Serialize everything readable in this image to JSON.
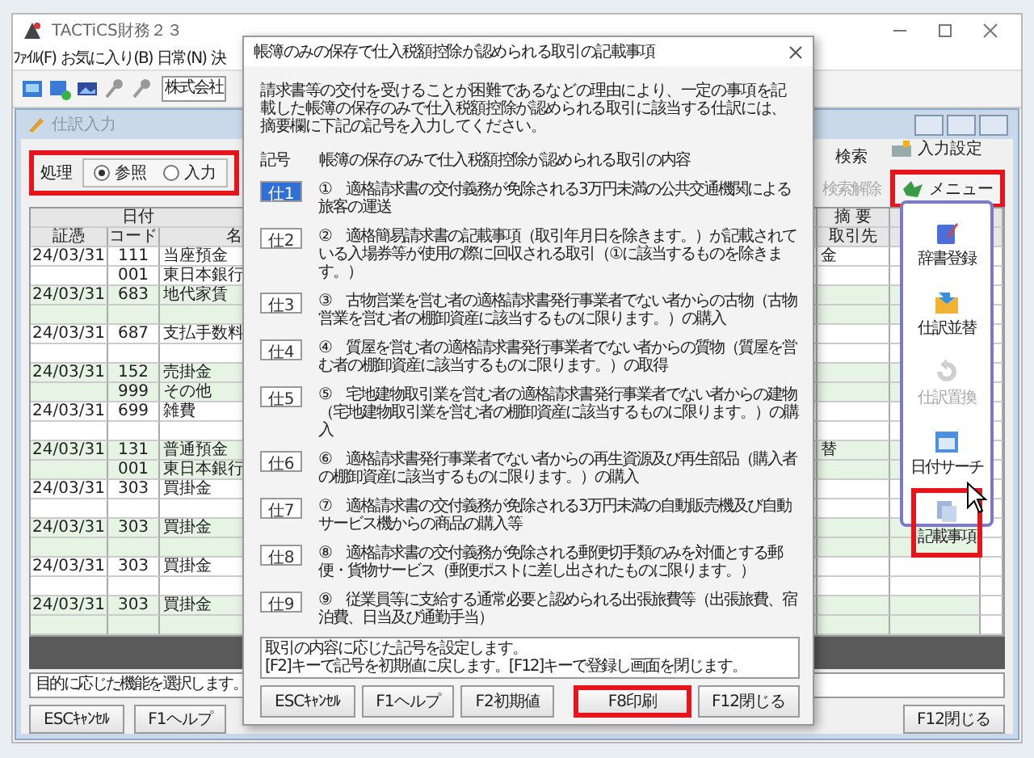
{
  "window": {
    "title": "TACTiCS財務２３"
  },
  "menu_bar": [
    "ﾌｧｲﾙ(F)",
    "お気に入り(B)",
    "日常(N)",
    "決"
  ],
  "toolbar": {
    "company_field": "株式会社"
  },
  "journal_window": {
    "title": "仕訳入力",
    "mode": {
      "label": "処理",
      "highlighted": true,
      "options": [
        {
          "label": "参照",
          "selected": true
        },
        {
          "label": "入力",
          "selected": false
        }
      ]
    },
    "search": "検索",
    "search_clear": {
      "label": "検索解除",
      "disabled": true
    },
    "input_settings": "入力設定",
    "menu_button": {
      "label": "メニュー",
      "highlighted": true
    },
    "table": {
      "date_header": "日付",
      "summary_header": "摘 要",
      "columns": [
        "証憑",
        "コード",
        "名"
      ],
      "partner_header": "取引先",
      "rows": [
        {
          "date": "24/03/31",
          "code": "111",
          "name": "当座預金",
          "summary": "金",
          "shaded": false
        },
        {
          "code": "001",
          "name": "東日本銀行",
          "shaded": false
        },
        {
          "date": "24/03/31",
          "code": "683",
          "name": "地代家賃",
          "shaded": true
        },
        {
          "shaded": true
        },
        {
          "date": "24/03/31",
          "code": "687",
          "name": "支払手数料",
          "shaded": false
        },
        {
          "shaded": false
        },
        {
          "date": "24/03/31",
          "code": "152",
          "name": "売掛金",
          "shaded": true
        },
        {
          "code": "999",
          "name": "その他",
          "shaded": true
        },
        {
          "date": "24/03/31",
          "code": "699",
          "name": "雑費",
          "shaded": false
        },
        {
          "shaded": false
        },
        {
          "date": "24/03/31",
          "code": "131",
          "name": "普通預金",
          "summary": "替",
          "shaded": true
        },
        {
          "code": "001",
          "name": "東日本銀行",
          "shaded": true
        },
        {
          "date": "24/03/31",
          "code": "303",
          "name": "買掛金",
          "shaded": false
        },
        {
          "shaded": false
        },
        {
          "date": "24/03/31",
          "code": "303",
          "name": "買掛金",
          "shaded": true
        },
        {
          "shaded": true
        },
        {
          "date": "24/03/31",
          "code": "303",
          "name": "買掛金",
          "shaded": false
        },
        {
          "shaded": false
        },
        {
          "date": "24/03/31",
          "code": "303",
          "name": "買掛金",
          "shaded": true
        },
        {
          "shaded": true
        }
      ]
    },
    "status_text": "目的に応じた機能を選択します。",
    "footer_buttons_left": [
      "ESCｷｬﾝｾﾙ",
      "F1ヘルプ"
    ],
    "footer_buttons_right": [
      "F12閉じる"
    ],
    "menu_panel": [
      {
        "kind": "dictionary",
        "label": "辞書登録",
        "disabled": false,
        "highlighted": false
      },
      {
        "kind": "sort",
        "label": "仕訳並替",
        "disabled": false,
        "highlighted": false
      },
      {
        "kind": "replace",
        "label": "仕訳置換",
        "disabled": true,
        "highlighted": false
      },
      {
        "kind": "calendar",
        "label": "日付サーチ",
        "disabled": false,
        "highlighted": false
      },
      {
        "kind": "notes",
        "label": "記載事項",
        "disabled": false,
        "highlighted": true
      }
    ]
  },
  "dialog": {
    "title": "帳簿のみの保存で仕入税額控除が認められる取引の記載事項",
    "intro": "請求書等の交付を受けることが困難であるなどの理由により、一定の事項を記載した帳簿の保存のみで仕入税額控除が認められる取引に該当する仕訳には、摘要欄に下記の記号を入力してください。",
    "header": {
      "code": "記号",
      "content": "帳簿の保存のみで仕入税額控除が認められる取引の内容"
    },
    "items": [
      {
        "code": "仕1",
        "selected": true,
        "text": "①　適格請求書の交付義務が免除される3万円未満の公共交通機関による旅客の運送"
      },
      {
        "code": "仕2",
        "selected": false,
        "text": "②　適格簡易請求書の記載事項（取引年月日を除きます。）が記載されている入場券等が使用の際に回収される取引（①に該当するものを除きます。）"
      },
      {
        "code": "仕3",
        "selected": false,
        "text": "③　古物営業を営む者の適格請求書発行事業者でない者からの古物（古物営業を営む者の棚卸資産に該当するものに限ります。）の購入"
      },
      {
        "code": "仕4",
        "selected": false,
        "text": "④　質屋を営む者の適格請求書発行事業者でない者からの質物（質屋を営む者の棚卸資産に該当するものに限ります。）の取得"
      },
      {
        "code": "仕5",
        "selected": false,
        "text": "⑤　宅地建物取引業を営む者の適格請求書発行事業者でない者からの建物（宅地建物取引業を営む者の棚卸資産に該当するものに限ります。）の購入"
      },
      {
        "code": "仕6",
        "selected": false,
        "text": "⑥　適格請求書発行事業者でない者からの再生資源及び再生部品（購入者の棚卸資産に該当するものに限ります。）の購入"
      },
      {
        "code": "仕7",
        "selected": false,
        "text": "⑦　適格請求書の交付義務が免除される3万円未満の自動販売機及び自動サービス機からの商品の購入等"
      },
      {
        "code": "仕8",
        "selected": false,
        "text": "⑧　適格請求書の交付義務が免除される郵便切手類のみを対価とする郵便・貨物サービス（郵便ポストに差し出されたものに限ります。）"
      },
      {
        "code": "仕9",
        "selected": false,
        "text": "⑨　従業員等に支給する通常必要と認められる出張旅費等（出張旅費、宿泊費、日当及び通勤手当）"
      }
    ],
    "help": [
      "取引の内容に応じた記号を設定します。",
      "[F2]キーで記号を初期値に戻します。[F12]キーで登録し画面を閉じます。"
    ],
    "buttons_left": [
      {
        "label": "ESCｷｬﾝｾﾙ",
        "highlighted": false
      },
      {
        "label": "F1ヘルプ",
        "highlighted": false
      },
      {
        "label": "F2初期値",
        "highlighted": false
      }
    ],
    "buttons_right": [
      {
        "label": "F8印刷",
        "highlighted": true
      },
      {
        "label": "F12閉じる",
        "highlighted": false
      }
    ]
  }
}
